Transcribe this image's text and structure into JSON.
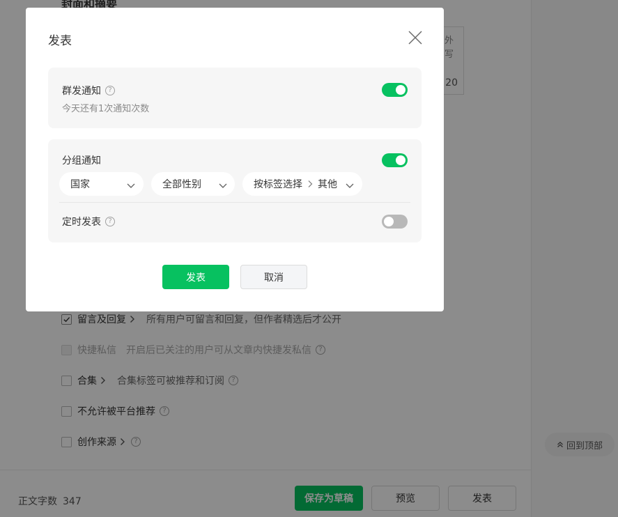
{
  "page": {
    "cover_title": "封面和摘要",
    "cover_box": {
      "line1": "外",
      "line2": "写",
      "count": "20"
    },
    "options": [
      {
        "label": "留言及回复",
        "desc": "所有用户可留言和回复，但作者精选后才公开",
        "checked": true,
        "disabled": false,
        "has_chevron": true,
        "has_help": false
      },
      {
        "label": "快捷私信",
        "desc": "开启后已关注的用户可从文章内快捷发私信",
        "checked": false,
        "disabled": true,
        "has_chevron": false,
        "has_help": true
      },
      {
        "label": "合集",
        "desc": "合集标签可被推荐和订阅",
        "checked": false,
        "disabled": false,
        "has_chevron": true,
        "has_help": true
      },
      {
        "label": "不允许被平台推荐",
        "desc": "",
        "checked": false,
        "disabled": false,
        "has_chevron": false,
        "has_help": true
      },
      {
        "label": "创作来源",
        "desc": "",
        "checked": false,
        "disabled": false,
        "has_chevron": true,
        "has_help": true
      }
    ],
    "back_to_top": "回到顶部",
    "bottom_bar": {
      "wordcount_label": "正文字数",
      "wordcount_value": "347",
      "save_draft": "保存为草稿",
      "preview": "预览",
      "publish": "发表"
    }
  },
  "dialog": {
    "title": "发表",
    "mass_notify": {
      "label": "群发通知",
      "sub": "今天还有1次通知次数",
      "enabled": true
    },
    "group_notify": {
      "label": "分组通知",
      "enabled": true,
      "country": "国家",
      "gender": "全部性别",
      "tag_select": "按标签选择",
      "tag_value": "其他"
    },
    "scheduled": {
      "label": "定时发表",
      "enabled": false
    },
    "publish_button": "发表",
    "cancel_button": "取消"
  },
  "colors": {
    "accent": "#07c160",
    "toggle_off": "#b8b8b8"
  }
}
